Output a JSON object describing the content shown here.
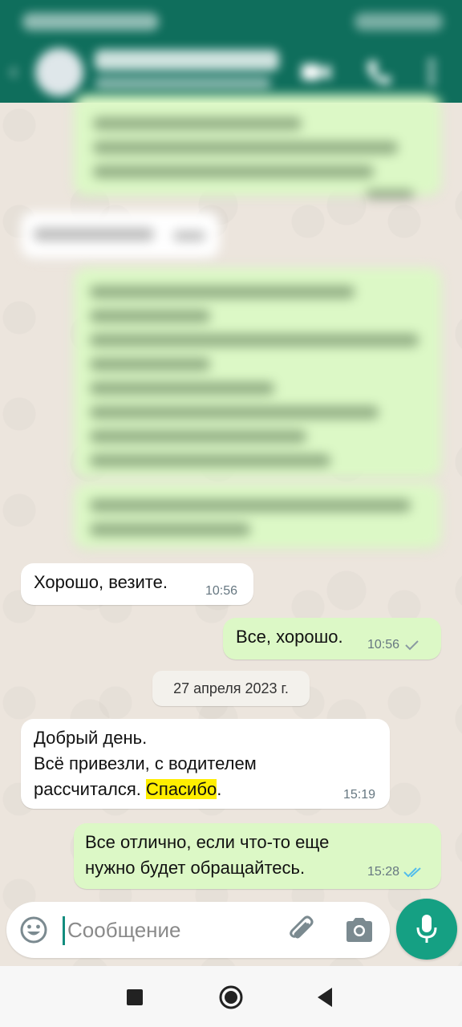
{
  "chat": {
    "messages": [
      {
        "direction": "in",
        "text": "Хорошо, везите.",
        "time": "10:56"
      },
      {
        "direction": "out",
        "text": "Все, хорошо.",
        "time": "10:56",
        "status": "sent"
      },
      {
        "direction": "in",
        "text_lines": [
          "Добрый день.",
          "Всё привезли, с водителем"
        ],
        "text_pre": "рассчитался. ",
        "highlight": "Спасибо",
        "text_post": ".",
        "time": "15:19"
      },
      {
        "direction": "out",
        "text_lines": [
          "Все отлично, если что-то еще",
          "нужно будет обращайтесь."
        ],
        "time": "15:28",
        "status": "read"
      }
    ],
    "date_separator": "27 апреля 2023 г."
  },
  "composer": {
    "placeholder": "Сообщение",
    "icons": [
      "emoji-icon",
      "attach-icon",
      "camera-icon",
      "mic-icon"
    ]
  },
  "header": {
    "icons": [
      "back-icon",
      "video-call-icon",
      "voice-call-icon",
      "more-icon"
    ]
  },
  "nav": {
    "icons": [
      "recents-icon",
      "home-icon",
      "back-icon"
    ]
  },
  "colors": {
    "header": "#0f6e5c",
    "outgoing_bubble": "#dcf8c6",
    "incoming_bubble": "#ffffff",
    "accent": "#15a083",
    "read_ticks": "#53bdeb",
    "highlight": "#ffee00"
  }
}
